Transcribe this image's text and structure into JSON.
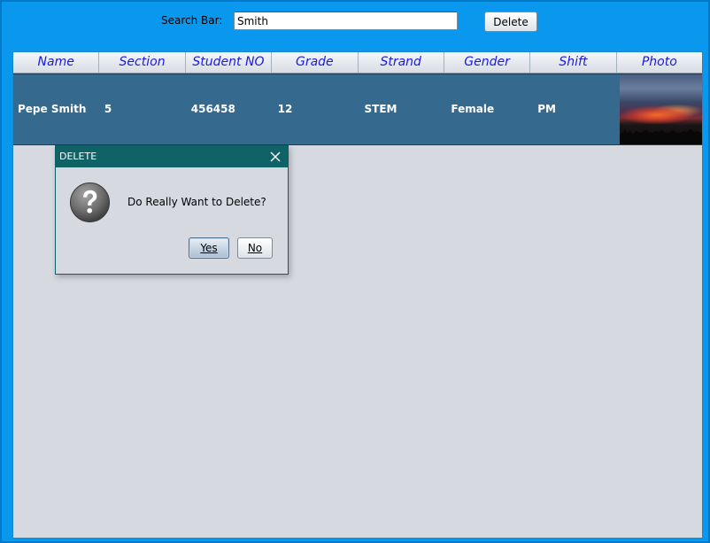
{
  "search": {
    "label": "Search Bar:",
    "value": "Smith",
    "placeholder": ""
  },
  "toolbar": {
    "delete_label": "Delete"
  },
  "table": {
    "columns": [
      "Name",
      "Section",
      "Student NO",
      "Grade",
      "Strand",
      "Gender",
      "Shift",
      "Photo"
    ],
    "rows": [
      {
        "name": "Pepe Smith",
        "section": "5",
        "student_no": "456458",
        "grade": "12",
        "strand": "STEM",
        "gender": "Female",
        "shift": "PM",
        "photo": "sunset-photo"
      }
    ]
  },
  "dialog": {
    "title": "DELETE",
    "message": "Do Really Want to Delete?",
    "yes_label": "Yes",
    "no_label": "No",
    "icon": "question-icon",
    "close_icon": "close-icon"
  },
  "colors": {
    "window_bg": "#0a98ef",
    "panel_bg": "#d6d9e0",
    "header_text": "#1a1ae0",
    "selected_row": "#356a8e",
    "dialog_titlebar": "#0f6366"
  }
}
